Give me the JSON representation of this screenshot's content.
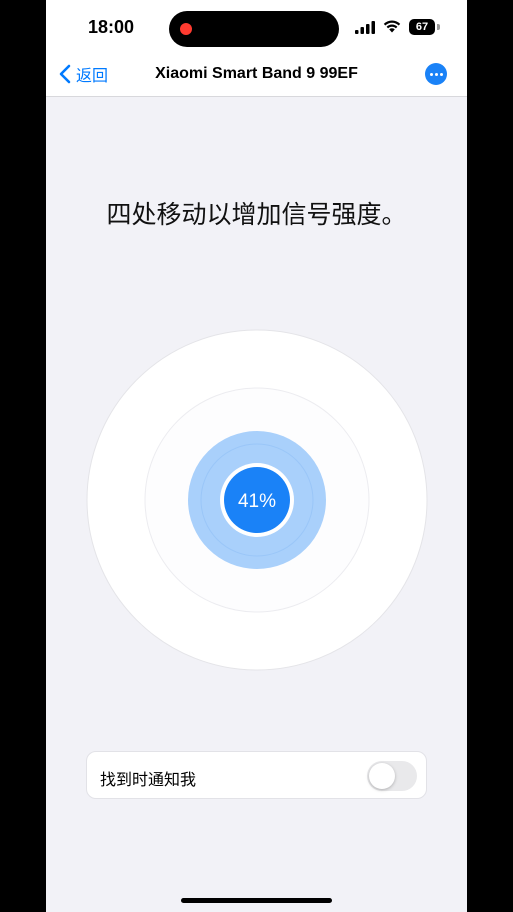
{
  "status_bar": {
    "time": "18:00",
    "battery_level": "67",
    "recording_indicator_color": "#ff3b30"
  },
  "nav": {
    "back_label": "返回",
    "title": "Xiaomi Smart Band 9 99EF",
    "more_icon": "ellipsis-circle-icon"
  },
  "instruction": "四处移动以增加信号强度。",
  "signal": {
    "percent_label": "41%",
    "strength": 0.41
  },
  "notify": {
    "label": "找到时通知我",
    "enabled": false
  },
  "colors": {
    "accent": "#007aff",
    "signal_blue": "#1a82f7",
    "signal_halo": "#a9d0fb",
    "background": "#f2f2f7"
  }
}
